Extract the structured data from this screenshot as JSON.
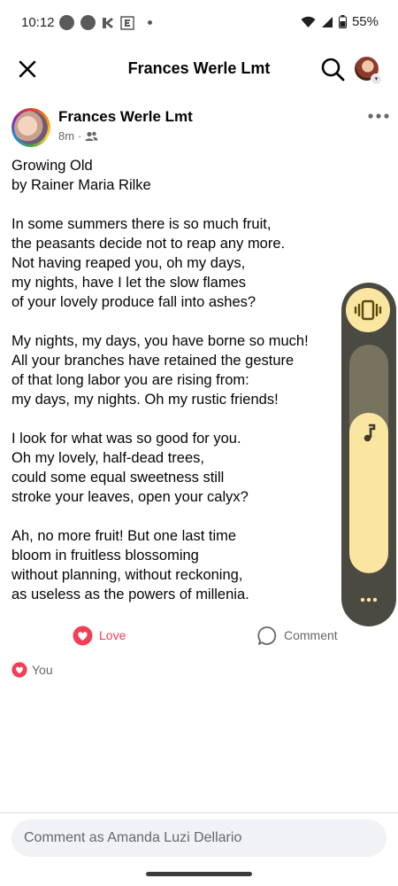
{
  "status_bar": {
    "time": "10:12",
    "battery": "55%"
  },
  "header": {
    "title": "Frances Werle Lmt",
    "icons": [
      "close-icon",
      "search-icon",
      "profile-avatar"
    ]
  },
  "post": {
    "author": "Frances Werle Lmt",
    "time": "8m",
    "separator": "·",
    "audience_icon": "friends-icon",
    "stanzas": [
      [
        "Growing Old",
        "by Rainer Maria Rilke"
      ],
      [
        "In some summers there is so much fruit,",
        "the peasants decide not to reap any more.",
        "Not having reaped you, oh my days,",
        "my nights, have I let the slow flames",
        "of your lovely produce fall into ashes?"
      ],
      [
        "My nights, my days, you have borne so much!",
        "All your branches have retained the gesture",
        "of that long labor you are rising from:",
        "my days, my nights. Oh my rustic friends!"
      ],
      [
        "I look for what was so good for you.",
        "Oh my lovely, half-dead trees,",
        "could some equal sweetness still",
        "stroke your leaves, open your calyx?"
      ],
      [
        "Ah, no more fruit! But one last time",
        "bloom in fruitless blossoming",
        "without planning, without reckoning,",
        "as useless as the powers of millenia."
      ]
    ]
  },
  "actions": {
    "love_label": "Love",
    "comment_label": "Comment",
    "reacted_by": "You"
  },
  "volume_panel": {
    "mode_icon": "vibrate-icon",
    "stream_icon": "music-note-icon",
    "level_fraction": 0.7
  },
  "composer": {
    "placeholder": "Comment as Amanda Luzi Dellario"
  },
  "colors": {
    "love": "#f33e58",
    "volume_accent": "#fbe6a1",
    "volume_panel": "#4b4a42"
  }
}
